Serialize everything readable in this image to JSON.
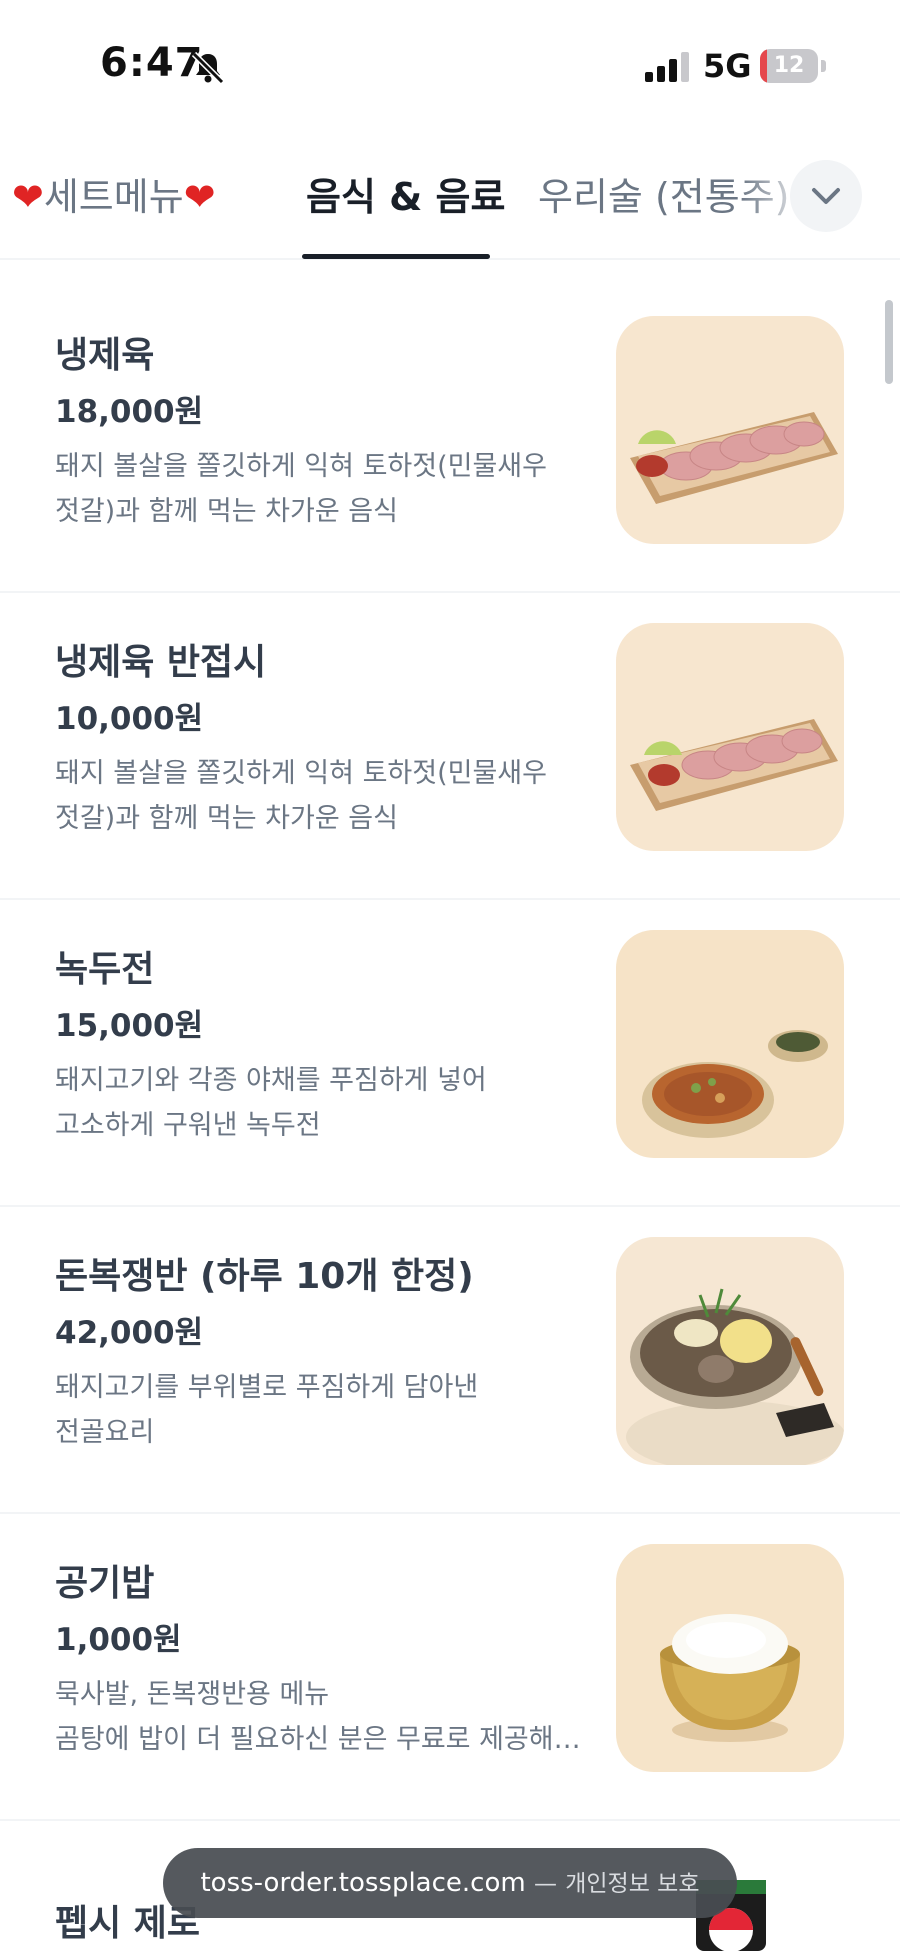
{
  "status_bar": {
    "time": "6:47",
    "network": "5G",
    "battery": "12",
    "battery_level": 0.12
  },
  "tabs": [
    {
      "label": "세트메뉴",
      "active": false
    },
    {
      "label": "음식 & 음료",
      "active": true
    },
    {
      "label": "우리술 (전통주)",
      "active": false
    }
  ],
  "menu_items": [
    {
      "name": "냉제육",
      "price": "18,000원",
      "desc_line1": "돼지 볼살을 쫄깃하게 익혀 토하젓(민물새우",
      "desc_line2": "젓갈)과 함께 먹는 차가운 음식"
    },
    {
      "name": "냉제육 반접시",
      "price": "10,000원",
      "desc_line1": "돼지 볼살을 쫄깃하게 익혀 토하젓(민물새우",
      "desc_line2": "젓갈)과 함께 먹는 차가운 음식"
    },
    {
      "name": "녹두전",
      "price": "15,000원",
      "desc_line1": "돼지고기와 각종 야채를 푸짐하게 넣어",
      "desc_line2": "고소하게 구워낸 녹두전"
    },
    {
      "name": "돈복쟁반 (하루 10개 한정)",
      "price": "42,000원",
      "desc_line1": "돼지고기를 부위별로 푸짐하게 담아낸",
      "desc_line2": "전골요리"
    },
    {
      "name": "공기밥",
      "price": "1,000원",
      "desc_line1": "묵사발, 돈복쟁반용 메뉴",
      "desc_line2": "곰탕에 밥이 더 필요하신 분은 무료로 제공해 ..."
    }
  ],
  "next_item": {
    "name": "펩시 제로"
  },
  "url_bar": {
    "domain": "toss-order.tossplace.com",
    "separator": "—",
    "privacy": "개인정보 보호"
  },
  "colors": {
    "text_primary": "#333d4b",
    "text_secondary": "#6b7684",
    "divider": "#f2f4f6",
    "thumb_bg": "#f7e8d2"
  }
}
